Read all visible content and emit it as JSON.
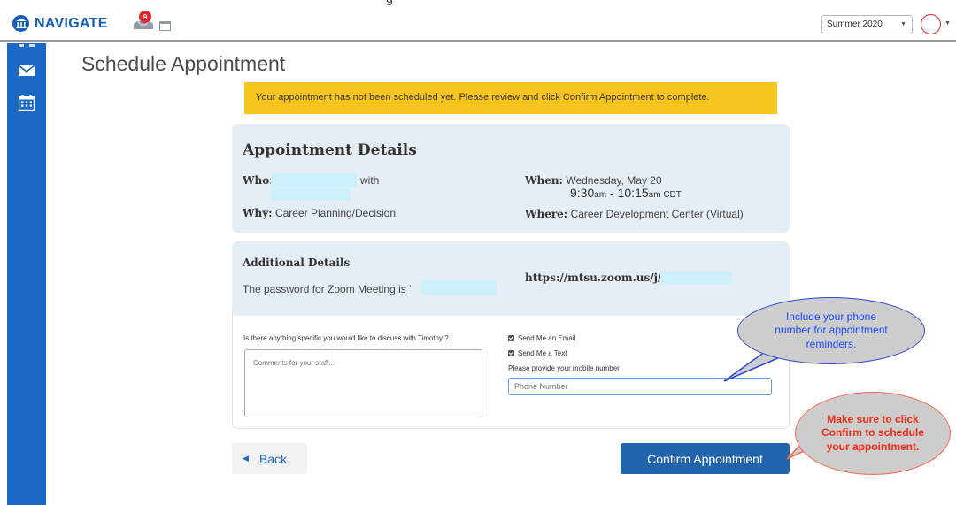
{
  "header": {
    "logo_text": "NAVIGATE",
    "notification_count": "9",
    "term_value": "Summer 2020",
    "brand_color": "#1760b6"
  },
  "top_cut_text": "g",
  "page": {
    "title": "Schedule Appointment",
    "warning": "Your appointment has not been scheduled yet. Please review and click Confirm Appointment to complete."
  },
  "details": {
    "title": "Appointment Details",
    "who_label": "Who:",
    "who_connector": "with",
    "why_label": "Why:",
    "why_value": "Career Planning/Decision",
    "when_label": "When:",
    "when_date": "Wednesday, May 20",
    "time_start": "9:30",
    "time_start_suffix": "am",
    "time_separator": " - ",
    "time_end": "10:15",
    "time_end_suffix": "am CDT",
    "where_label": "Where:",
    "where_value": "Career Development Center (Virtual)"
  },
  "additional": {
    "title": "Additional Details",
    "password_text": "The password for Zoom Meeting is '",
    "zoom_url": "https://mtsu.zoom.us/j/"
  },
  "form": {
    "question": "Is there anything specific you would like to discuss with Timothy ?",
    "comments_placeholder": "Comments for your staff...",
    "send_email_label": "Send Me an Email",
    "send_text_label": "Send Me a Text",
    "mobile_label": "Please provide your mobile number",
    "phone_placeholder": "Phone Number"
  },
  "buttons": {
    "back_label": "Back",
    "confirm_label": "Confirm Appointment"
  },
  "callouts": {
    "phone_tip": "Include your phone number for appointment reminders.",
    "confirm_tip": "Make sure to click Confirm to schedule your appointment."
  }
}
